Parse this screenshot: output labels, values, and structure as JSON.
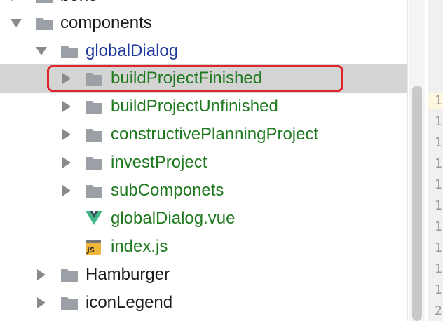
{
  "tree": {
    "rows": [
      {
        "label": "bone",
        "color": "black",
        "icon": "folder-icon",
        "arrow": "right"
      },
      {
        "label": "components",
        "color": "black",
        "icon": "folder-icon",
        "arrow": "down"
      },
      {
        "label": "globalDialog",
        "color": "blue",
        "icon": "folder-icon",
        "arrow": "down"
      },
      {
        "label": "buildProjectFinished",
        "color": "green",
        "icon": "folder-icon",
        "arrow": "right",
        "selected": true
      },
      {
        "label": "buildProjectUnfinished",
        "color": "green",
        "icon": "folder-icon",
        "arrow": "right"
      },
      {
        "label": "constructivePlanningProject",
        "color": "green",
        "icon": "folder-icon",
        "arrow": "right"
      },
      {
        "label": "investProject",
        "color": "green",
        "icon": "folder-icon",
        "arrow": "right"
      },
      {
        "label": "subComponets",
        "color": "green",
        "icon": "folder-icon",
        "arrow": "right"
      },
      {
        "label": "globalDialog.vue",
        "color": "green",
        "icon": "vue-file-icon"
      },
      {
        "label": "index.js",
        "color": "green",
        "icon": "js-file-icon",
        "icon_text": "JS"
      },
      {
        "label": "Hamburger",
        "color": "black",
        "icon": "folder-icon",
        "arrow": "right"
      },
      {
        "label": "iconLegend",
        "color": "black",
        "icon": "folder-icon",
        "arrow": "right"
      }
    ]
  },
  "gutter": {
    "line_numbers": [
      "1",
      "1",
      "1",
      "1",
      "1",
      "1",
      "1",
      "1",
      "1",
      "1",
      "2"
    ]
  },
  "colors": {
    "selection": "#d4d4d4",
    "highlight_border": "#e0242b",
    "folder": "#9aa0a6",
    "green_text": "#1f7a1f",
    "blue_text": "#1f3a9a"
  }
}
